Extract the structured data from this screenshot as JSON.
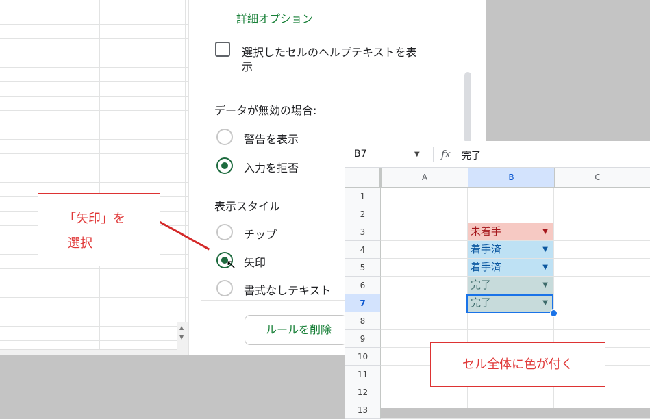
{
  "dialog": {
    "advanced_options": "詳細オプション",
    "help_text_checkbox": {
      "line1": "選択したセルのヘルプテキストを表",
      "line2": "示",
      "checked": false
    },
    "invalid_data_label": "データが無効の場合:",
    "invalid_options": [
      {
        "label": "警告を表示",
        "selected": false
      },
      {
        "label": "入力を拒否",
        "selected": true
      }
    ],
    "display_style_label": "表示スタイル",
    "display_options": [
      {
        "label": "チップ",
        "selected": false
      },
      {
        "label": "矢印",
        "selected": true
      },
      {
        "label": "書式なしテキスト",
        "selected": false
      }
    ],
    "remove_rule_button": "ルールを削除"
  },
  "sheet": {
    "name_box": "B7",
    "fx": "fx",
    "formula_value": "完了",
    "columns": [
      "A",
      "B",
      "C"
    ],
    "selected_column": "B",
    "rows": [
      "1",
      "2",
      "3",
      "4",
      "5",
      "6",
      "7",
      "8",
      "9",
      "10",
      "11",
      "12",
      "13"
    ],
    "selected_row": "7",
    "cells": [
      {
        "row": "3",
        "value": "未着手",
        "bg": "#f6c9c3",
        "fg": "#a5161b"
      },
      {
        "row": "4",
        "value": "着手済",
        "bg": "#bee1f4",
        "fg": "#0b57a0"
      },
      {
        "row": "5",
        "value": "着手済",
        "bg": "#bee1f4",
        "fg": "#0b57a0"
      },
      {
        "row": "6",
        "value": "完了",
        "bg": "#c7dbdb",
        "fg": "#3d6b6b"
      },
      {
        "row": "7",
        "value": "完了",
        "bg": "#c7dbdb",
        "fg": "#3d6b6b"
      }
    ]
  },
  "annotations": {
    "left_callout_line1": "「矢印」を",
    "left_callout_line2": "選択",
    "right_callout": "セル全体に色が付く"
  }
}
